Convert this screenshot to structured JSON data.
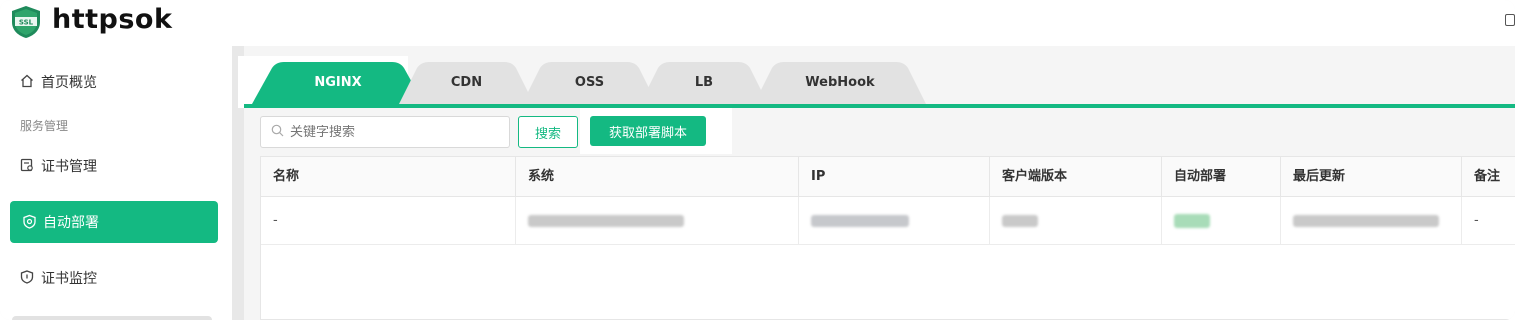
{
  "header": {
    "brand": "httpsok",
    "logo_text": "SSL"
  },
  "sidebar": {
    "items": [
      {
        "label": "首页概览",
        "icon": "home-icon"
      },
      {
        "label": "证书管理",
        "icon": "certificate-icon"
      },
      {
        "label": "自动部署",
        "icon": "deploy-icon",
        "active": true
      },
      {
        "label": "证书监控",
        "icon": "shield-icon"
      }
    ],
    "group_label": "服务管理"
  },
  "tabs": [
    {
      "label": "NGINX",
      "active": true
    },
    {
      "label": "CDN"
    },
    {
      "label": "OSS"
    },
    {
      "label": "LB"
    },
    {
      "label": "WebHook"
    }
  ],
  "search": {
    "placeholder": "关键字搜索",
    "search_label": "搜索",
    "script_label": "获取部署脚本"
  },
  "table": {
    "columns": [
      "名称",
      "系统",
      "IP",
      "客户端版本",
      "自动部署",
      "最后更新",
      "备注"
    ],
    "rows": [
      {
        "name": "-",
        "remark": "-"
      }
    ]
  },
  "colors": {
    "accent": "#14b982"
  }
}
